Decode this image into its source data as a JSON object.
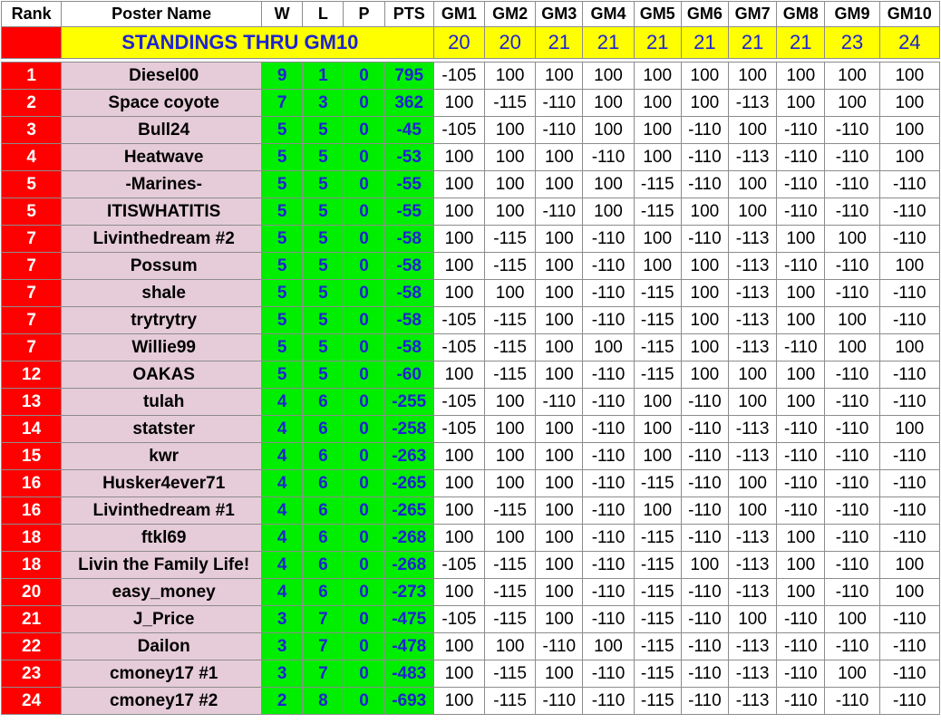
{
  "table": {
    "headers": [
      "Rank",
      "Poster Name",
      "W",
      "L",
      "P",
      "PTS",
      "GM1",
      "GM2",
      "GM3",
      "GM4",
      "GM5",
      "GM6",
      "GM7",
      "GM8",
      "GM9",
      "GM10"
    ],
    "title": "STANDINGS THRU GM10",
    "game_counts": [
      "20",
      "20",
      "21",
      "21",
      "21",
      "21",
      "21",
      "21",
      "23",
      "24"
    ],
    "rows": [
      {
        "rank": "1",
        "name": "Diesel00",
        "w": "9",
        "l": "1",
        "p": "0",
        "pts": "795",
        "games": [
          "-105",
          "100",
          "100",
          "100",
          "100",
          "100",
          "100",
          "100",
          "100",
          "100"
        ]
      },
      {
        "rank": "2",
        "name": "Space coyote",
        "w": "7",
        "l": "3",
        "p": "0",
        "pts": "362",
        "games": [
          "100",
          "-115",
          "-110",
          "100",
          "100",
          "100",
          "-113",
          "100",
          "100",
          "100"
        ]
      },
      {
        "rank": "3",
        "name": "Bull24",
        "w": "5",
        "l": "5",
        "p": "0",
        "pts": "-45",
        "games": [
          "-105",
          "100",
          "-110",
          "100",
          "100",
          "-110",
          "100",
          "-110",
          "-110",
          "100"
        ]
      },
      {
        "rank": "4",
        "name": "Heatwave",
        "w": "5",
        "l": "5",
        "p": "0",
        "pts": "-53",
        "games": [
          "100",
          "100",
          "100",
          "-110",
          "100",
          "-110",
          "-113",
          "-110",
          "-110",
          "100"
        ]
      },
      {
        "rank": "5",
        "name": "-Marines-",
        "w": "5",
        "l": "5",
        "p": "0",
        "pts": "-55",
        "games": [
          "100",
          "100",
          "100",
          "100",
          "-115",
          "-110",
          "100",
          "-110",
          "-110",
          "-110"
        ]
      },
      {
        "rank": "5",
        "name": "ITISWHATITIS",
        "w": "5",
        "l": "5",
        "p": "0",
        "pts": "-55",
        "games": [
          "100",
          "100",
          "-110",
          "100",
          "-115",
          "100",
          "100",
          "-110",
          "-110",
          "-110"
        ]
      },
      {
        "rank": "7",
        "name": "Livinthedream #2",
        "w": "5",
        "l": "5",
        "p": "0",
        "pts": "-58",
        "games": [
          "100",
          "-115",
          "100",
          "-110",
          "100",
          "-110",
          "-113",
          "100",
          "100",
          "-110"
        ]
      },
      {
        "rank": "7",
        "name": "Possum",
        "w": "5",
        "l": "5",
        "p": "0",
        "pts": "-58",
        "games": [
          "100",
          "-115",
          "100",
          "-110",
          "100",
          "100",
          "-113",
          "-110",
          "-110",
          "100"
        ]
      },
      {
        "rank": "7",
        "name": "shale",
        "w": "5",
        "l": "5",
        "p": "0",
        "pts": "-58",
        "games": [
          "100",
          "100",
          "100",
          "-110",
          "-115",
          "100",
          "-113",
          "100",
          "-110",
          "-110"
        ]
      },
      {
        "rank": "7",
        "name": "trytrytry",
        "w": "5",
        "l": "5",
        "p": "0",
        "pts": "-58",
        "games": [
          "-105",
          "-115",
          "100",
          "-110",
          "-115",
          "100",
          "-113",
          "100",
          "100",
          "-110"
        ]
      },
      {
        "rank": "7",
        "name": "Willie99",
        "w": "5",
        "l": "5",
        "p": "0",
        "pts": "-58",
        "games": [
          "-105",
          "-115",
          "100",
          "100",
          "-115",
          "100",
          "-113",
          "-110",
          "100",
          "100"
        ]
      },
      {
        "rank": "12",
        "name": "OAKAS",
        "w": "5",
        "l": "5",
        "p": "0",
        "pts": "-60",
        "games": [
          "100",
          "-115",
          "100",
          "-110",
          "-115",
          "100",
          "100",
          "100",
          "-110",
          "-110"
        ]
      },
      {
        "rank": "13",
        "name": "tulah",
        "w": "4",
        "l": "6",
        "p": "0",
        "pts": "-255",
        "games": [
          "-105",
          "100",
          "-110",
          "-110",
          "100",
          "-110",
          "100",
          "100",
          "-110",
          "-110"
        ]
      },
      {
        "rank": "14",
        "name": "statster",
        "w": "4",
        "l": "6",
        "p": "0",
        "pts": "-258",
        "games": [
          "-105",
          "100",
          "100",
          "-110",
          "100",
          "-110",
          "-113",
          "-110",
          "-110",
          "100"
        ]
      },
      {
        "rank": "15",
        "name": "kwr",
        "w": "4",
        "l": "6",
        "p": "0",
        "pts": "-263",
        "games": [
          "100",
          "100",
          "100",
          "-110",
          "100",
          "-110",
          "-113",
          "-110",
          "-110",
          "-110"
        ]
      },
      {
        "rank": "16",
        "name": "Husker4ever71",
        "w": "4",
        "l": "6",
        "p": "0",
        "pts": "-265",
        "games": [
          "100",
          "100",
          "100",
          "-110",
          "-115",
          "-110",
          "100",
          "-110",
          "-110",
          "-110"
        ]
      },
      {
        "rank": "16",
        "name": "Livinthedream #1",
        "w": "4",
        "l": "6",
        "p": "0",
        "pts": "-265",
        "games": [
          "100",
          "-115",
          "100",
          "-110",
          "100",
          "-110",
          "100",
          "-110",
          "-110",
          "-110"
        ]
      },
      {
        "rank": "18",
        "name": "ftkl69",
        "w": "4",
        "l": "6",
        "p": "0",
        "pts": "-268",
        "games": [
          "100",
          "100",
          "100",
          "-110",
          "-115",
          "-110",
          "-113",
          "100",
          "-110",
          "-110"
        ]
      },
      {
        "rank": "18",
        "name": "Livin the Family Life!",
        "w": "4",
        "l": "6",
        "p": "0",
        "pts": "-268",
        "games": [
          "-105",
          "-115",
          "100",
          "-110",
          "-115",
          "100",
          "-113",
          "100",
          "-110",
          "100"
        ]
      },
      {
        "rank": "20",
        "name": "easy_money",
        "w": "4",
        "l": "6",
        "p": "0",
        "pts": "-273",
        "games": [
          "100",
          "-115",
          "100",
          "-110",
          "-115",
          "-110",
          "-113",
          "100",
          "-110",
          "100"
        ]
      },
      {
        "rank": "21",
        "name": "J_Price",
        "w": "3",
        "l": "7",
        "p": "0",
        "pts": "-475",
        "games": [
          "-105",
          "-115",
          "100",
          "-110",
          "-115",
          "-110",
          "100",
          "-110",
          "100",
          "-110"
        ]
      },
      {
        "rank": "22",
        "name": "Dailon",
        "w": "3",
        "l": "7",
        "p": "0",
        "pts": "-478",
        "games": [
          "100",
          "100",
          "-110",
          "100",
          "-115",
          "-110",
          "-113",
          "-110",
          "-110",
          "-110"
        ]
      },
      {
        "rank": "23",
        "name": "cmoney17 #1",
        "w": "3",
        "l": "7",
        "p": "0",
        "pts": "-483",
        "games": [
          "100",
          "-115",
          "100",
          "-110",
          "-115",
          "-110",
          "-113",
          "-110",
          "100",
          "-110"
        ]
      },
      {
        "rank": "24",
        "name": "cmoney17 #2",
        "w": "2",
        "l": "8",
        "p": "0",
        "pts": "-693",
        "games": [
          "100",
          "-115",
          "-110",
          "-110",
          "-115",
          "-110",
          "-113",
          "-110",
          "-110",
          "-110"
        ]
      }
    ]
  }
}
